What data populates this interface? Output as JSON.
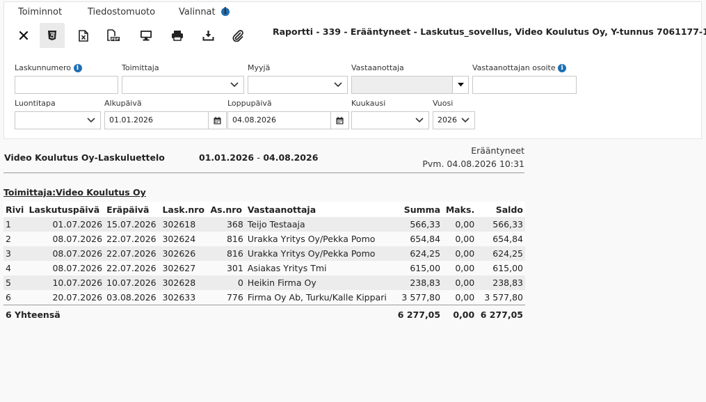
{
  "menu": {
    "actions": "Toiminnot",
    "format": "Tiedostomuoto",
    "options": "Valinnat"
  },
  "toolbar": [
    "close-icon",
    "html5-icon",
    "excel-icon",
    "pdf-icon",
    "monitor-icon",
    "print-icon",
    "download-icon",
    "paperclip-icon"
  ],
  "report_title": "Raportti - 339 - Erääntyneet - Laskutus_sovellus, Video Koulutus Oy, Y-tunnus 7061177-1",
  "filters": {
    "invoice_number": {
      "label": "Laskunnumero",
      "value": ""
    },
    "supplier": {
      "label": "Toimittaja",
      "value": ""
    },
    "seller": {
      "label": "Myyjä",
      "value": ""
    },
    "recipient": {
      "label": "Vastaanottaja",
      "value": ""
    },
    "recipient_address": {
      "label": "Vastaanottajan osoite",
      "value": ""
    },
    "creation_method": {
      "label": "Luontitapa",
      "value": ""
    },
    "start_date": {
      "label": "Alkupäivä",
      "value": "01.01.2026"
    },
    "end_date": {
      "label": "Loppupäivä",
      "value": "04.08.2026"
    },
    "month": {
      "label": "Kuukausi",
      "value": ""
    },
    "year": {
      "label": "Vuosi",
      "value": "2026"
    }
  },
  "report": {
    "list_title": "Video Koulutus Oy-Laskuluettelo",
    "date_from": "01.01.2026",
    "date_sep": "-",
    "date_to": "04.08.2026",
    "status": "Erääntyneet",
    "printed": "Pvm. 04.08.2026 10:31",
    "supplier_heading": "Toimittaja:Video Koulutus Oy",
    "columns": [
      "Rivi",
      "Laskutuspäivä",
      "Eräpäivä",
      "Lask.nro",
      "As.nro",
      "Vastaanottaja",
      "Summa",
      "Maks.",
      "Saldo"
    ],
    "rows": [
      [
        "1",
        "01.07.2026",
        "15.07.2026",
        "302618",
        "368",
        "Teijo Testaaja",
        "566,33",
        "0,00",
        "566,33"
      ],
      [
        "2",
        "08.07.2026",
        "22.07.2026",
        "302624",
        "816",
        "Urakka Yritys Oy/Pekka Pomo",
        "654,84",
        "0,00",
        "654,84"
      ],
      [
        "3",
        "08.07.2026",
        "22.07.2026",
        "302626",
        "816",
        "Urakka Yritys Oy/Pekka Pomo",
        "624,25",
        "0,00",
        "624,25"
      ],
      [
        "4",
        "08.07.2026",
        "22.07.2026",
        "302627",
        "301",
        "Asiakas Yritys Tmi",
        "615,00",
        "0,00",
        "615,00"
      ],
      [
        "5",
        "10.07.2026",
        "10.07.2026",
        "302628",
        "0",
        "Heikin Firma Oy",
        "238,83",
        "0,00",
        "238,83"
      ],
      [
        "6",
        "20.07.2026",
        "03.08.2026",
        "302633",
        "776",
        "Firma Oy Ab, Turku/Kalle Kippari",
        "3 577,80",
        "0,00",
        "3 577,80"
      ]
    ],
    "total": {
      "label": "6 Yhteensä",
      "sum": "6 277,05",
      "paid": "0,00",
      "balance": "6 277,05"
    }
  }
}
